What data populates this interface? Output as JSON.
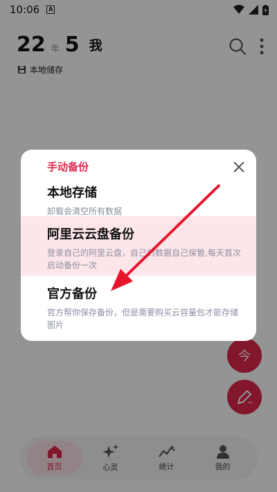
{
  "status_bar": {
    "time": "10:06",
    "a_label": "A"
  },
  "header": {
    "day": "22",
    "year_label": "年",
    "month": "5",
    "me": "我",
    "storage": "本地储存"
  },
  "fab": {
    "today": "今"
  },
  "nav": {
    "items": [
      {
        "label": "首页",
        "icon": "home-icon"
      },
      {
        "label": "心灵",
        "icon": "sparkle-icon"
      },
      {
        "label": "统计",
        "icon": "chart-line-icon"
      },
      {
        "label": "我的",
        "icon": "person-icon"
      }
    ],
    "active": 0
  },
  "dialog": {
    "title": "手动备份",
    "options": [
      {
        "title": "本地存储",
        "desc": "卸载会清空所有数据"
      },
      {
        "title": "阿里云云盘备份",
        "desc": "登录自己的阿里云盘，自己的数据自己保管,每天首次启动备份一次"
      },
      {
        "title": "官方备份",
        "desc": "官方帮你保存备份，但是需要购买云容量包才能存储图片"
      }
    ]
  },
  "colors": {
    "accent": "#e0294d",
    "highlight": "#fde6ea",
    "arrow": "#e8142c"
  }
}
